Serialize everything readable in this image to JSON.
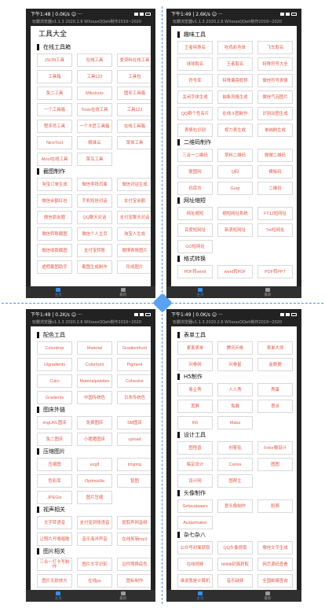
{
  "status": {
    "time1": "下午1:48 | 0.0K/s ☺ ···",
    "time2": "下午1:49 | 2.6K/s ☺ ···",
    "time3": "下午1:49 | 0.2K/s ☺ ···",
    "time4": "下午1:49 | 0.0K/s ☺ ···",
    "signal": "▮▮ ▮▮ 令 ▭"
  },
  "app_line": "玩霸浏览器v1.1.3 2020.2.6 WXsssxQQeh制作2019~2020",
  "panel1": {
    "title": "工具大全",
    "sections": [
      {
        "name": "在线工具箱",
        "items": [
          "JSON工具",
          "在线工具",
          "爱资料在线工具",
          "工具箱",
          "工具123",
          "工具包",
          "兔二工具",
          "Mikutools",
          "图安工具箱",
          "一个工具箱",
          "Toolz在线工具",
          "工具123",
          "程序员工具",
          "一个木匠工具箱",
          "在线工具箱",
          "NiceTool",
          "精准云",
          "菜体工具",
          "Atool在线工具",
          "菜鸟工具"
        ]
      },
      {
        "name": "截图制作",
        "items": [
          "淘宝订单生成",
          "微信零钱页面",
          "微信对话生成",
          "微信余额红包",
          "手机短信对话",
          "支付宝余额",
          "微信朋友圈",
          "QQ聊天对话",
          "支付宝聊天对话",
          "微信转账截图",
          "微信个人主页",
          "淘宝人生成",
          "微信收款截图",
          "支付宝转账",
          "微博表情图片",
          "虚假截图助手",
          "截图生成制作",
          "形成图片"
        ]
      }
    ]
  },
  "panel2": {
    "sections": [
      {
        "name": "趣味工具",
        "items": [
          "王者特殊名",
          "吃鸡彩色体",
          "飞车取名",
          "球球取名",
          "王者取名",
          "特殊符号大全",
          "符号库",
          "特殊偏旁昵称",
          "微信符号表情",
          "关闭字体生成",
          "抽象风格生成",
          "微信气泡图片",
          "QQ群个性名片",
          "在线斗图制作",
          "识别动图生成",
          "表情包识别",
          "视力表生成",
          "单纯刷生成"
        ]
      },
      {
        "name": "二维码制作",
        "items": [
          "三合一二维码",
          "草料二维码",
          "微微二维码",
          "联图网",
          "Q码",
          "模板码",
          "码库坊",
          "Goqr",
          "二维码"
        ]
      },
      {
        "name": "网址缩短",
        "items": [
          "网址缩短",
          "缩短网址系统",
          "FT12短网址",
          "百度短网址",
          "新浪短网址",
          "Tm短网址",
          "GO短网址"
        ]
      },
      {
        "name": "格式转换",
        "items": [
          "PDF转word",
          "word转PDF",
          "PDF转PPT"
        ]
      }
    ]
  },
  "panel3": {
    "sections": [
      {
        "name": "配色工具",
        "items": [
          "Colordrop",
          "Material",
          "Gradienthunt",
          "Uigradients",
          "Colorhunt",
          "Pigment",
          "Culrs",
          "Materialpalettes",
          "Cohesive",
          "Gradients",
          "中国传统色",
          "日本传统色"
        ]
      },
      {
        "name": "图床外链",
        "items": [
          "imgURL图床",
          "免费图床",
          "SM图床",
          "兔二图床",
          "小猪猪图床",
          "upload"
        ]
      },
      {
        "name": "压缩图片",
        "items": [
          "压缩图",
          "ezgif",
          "tinypng",
          "色彩库",
          "Optimizilla",
          "智图",
          "JPEGio",
          "图片压缩"
        ]
      },
      {
        "name": "视声相关",
        "items": [
          "文字转语音",
          "支付宝到账语音",
          "提取声网音频",
          "让照片开嘴唱歌",
          "音乐海洋声音",
          "在线剪辑mp3"
        ]
      },
      {
        "name": "图片相关",
        "items": [
          "三合一打卡写制作",
          "图片文字识别",
          "证件照换底色",
          "图片无损放大",
          "在线ps",
          "图标制作"
        ]
      }
    ]
  },
  "panel4": {
    "sections": [
      {
        "name": "表单工具",
        "items": [
          "麦客表单",
          "腾讯问卷",
          "表单大师",
          "问卷网",
          "问卷星",
          "金数据"
        ]
      },
      {
        "name": "H5制作",
        "items": [
          "易企秀",
          "人人秀",
          "秀蛋",
          "宽屏",
          "兔展",
          "意派",
          "Ih5",
          "Maka"
        ]
      },
      {
        "name": "设计工具",
        "items": [
          "图怪兽",
          "创客贴",
          "Fotor懒设计",
          "稿定设计",
          "Canva",
          "图图",
          "设计网",
          "图帮主"
        ]
      },
      {
        "name": "头像制作",
        "items": [
          "Getavataaars",
          "意头像制作",
          "脸萌",
          "Avatarmaker"
        ]
      },
      {
        "name": "杂七杂八",
        "items": [
          "公众号封面获取",
          "QQ头像提取",
          "微信文字生成",
          "在线视频",
          "bilibili封面获取",
          "网页源码查看",
          "谁说我是计算机",
          "音乐缺频",
          "全国邮编查询"
        ]
      }
    ]
  },
  "nav": {
    "home": "主页",
    "latest": "最新"
  }
}
